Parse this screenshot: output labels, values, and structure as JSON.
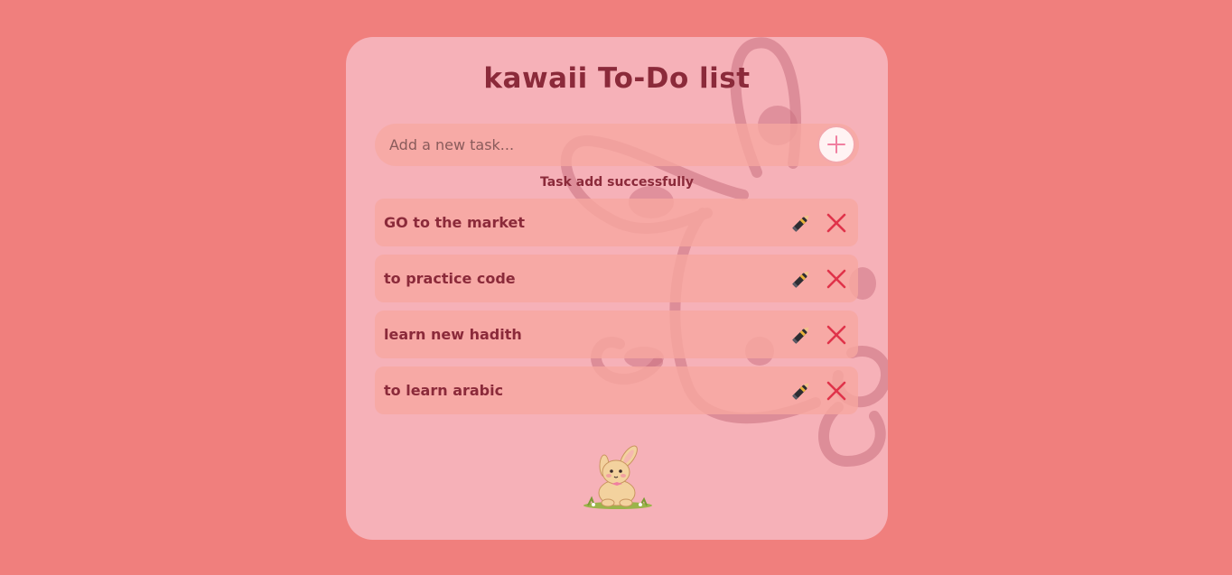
{
  "app": {
    "title": "kawaii To-Do list"
  },
  "input": {
    "placeholder": "Add a new task...",
    "value": "",
    "add_icon": "plus-icon"
  },
  "status_message": "Task add successfully",
  "tasks": [
    {
      "text": "GO to the market",
      "edit_icon": "pen-icon",
      "delete_icon": "close-icon"
    },
    {
      "text": "to practice code",
      "edit_icon": "pen-icon",
      "delete_icon": "close-icon"
    },
    {
      "text": "learn new hadith",
      "edit_icon": "pen-icon",
      "delete_icon": "close-icon"
    },
    {
      "text": "to learn arabic",
      "edit_icon": "pen-icon",
      "delete_icon": "close-icon"
    }
  ],
  "colors": {
    "page_background": "#f07f7d",
    "card_background": "#f6b1b8",
    "text_accent": "#8b2a3a",
    "delete_red": "#e0334a"
  }
}
